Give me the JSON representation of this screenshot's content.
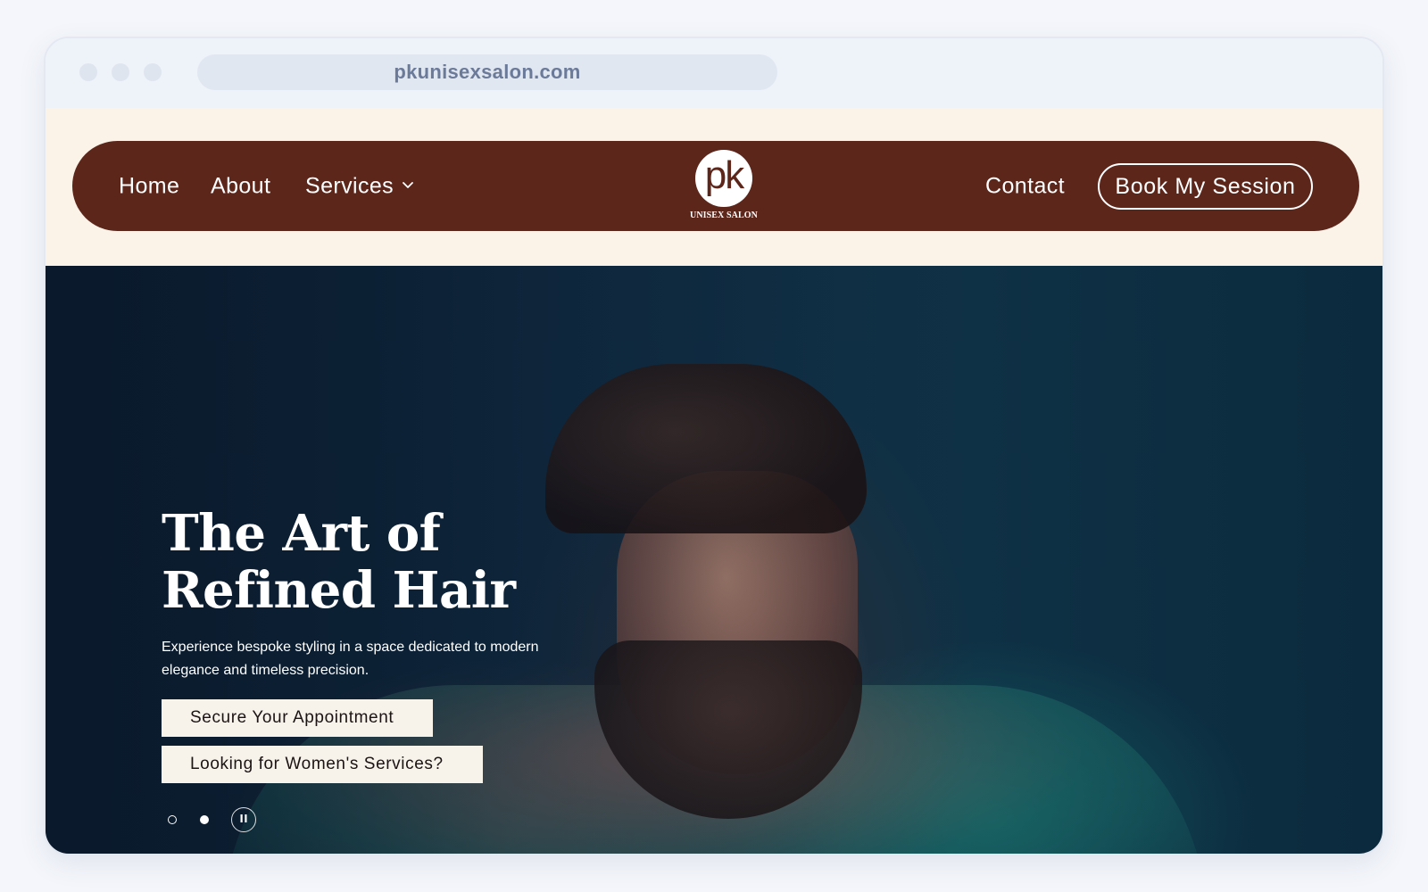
{
  "browser": {
    "url": "pkunisexsalon.com"
  },
  "navbar": {
    "items": [
      {
        "label": "Home"
      },
      {
        "label": "About"
      },
      {
        "label": "Services",
        "icon": "chevron-down-icon"
      },
      {
        "label": "Contact"
      }
    ],
    "book_button": "Book My Session",
    "logo": {
      "mark": "pk",
      "subtitle": "UNISEX SALON"
    }
  },
  "hero": {
    "title": "The Art of Refined Hair",
    "subtitle": "Experience bespoke styling in a space dedicated to modern elegance and timeless precision.",
    "cta_primary": "Secure Your Appointment",
    "cta_secondary": "Looking for Women's Services?",
    "slider": {
      "slide_count": 2,
      "active_slide": 2,
      "pause_icon": "pause-icon"
    }
  },
  "colors": {
    "brand_brown": "#5c261b",
    "nav_background": "#fbf2e8",
    "cta_background": "#f7f2ea"
  }
}
